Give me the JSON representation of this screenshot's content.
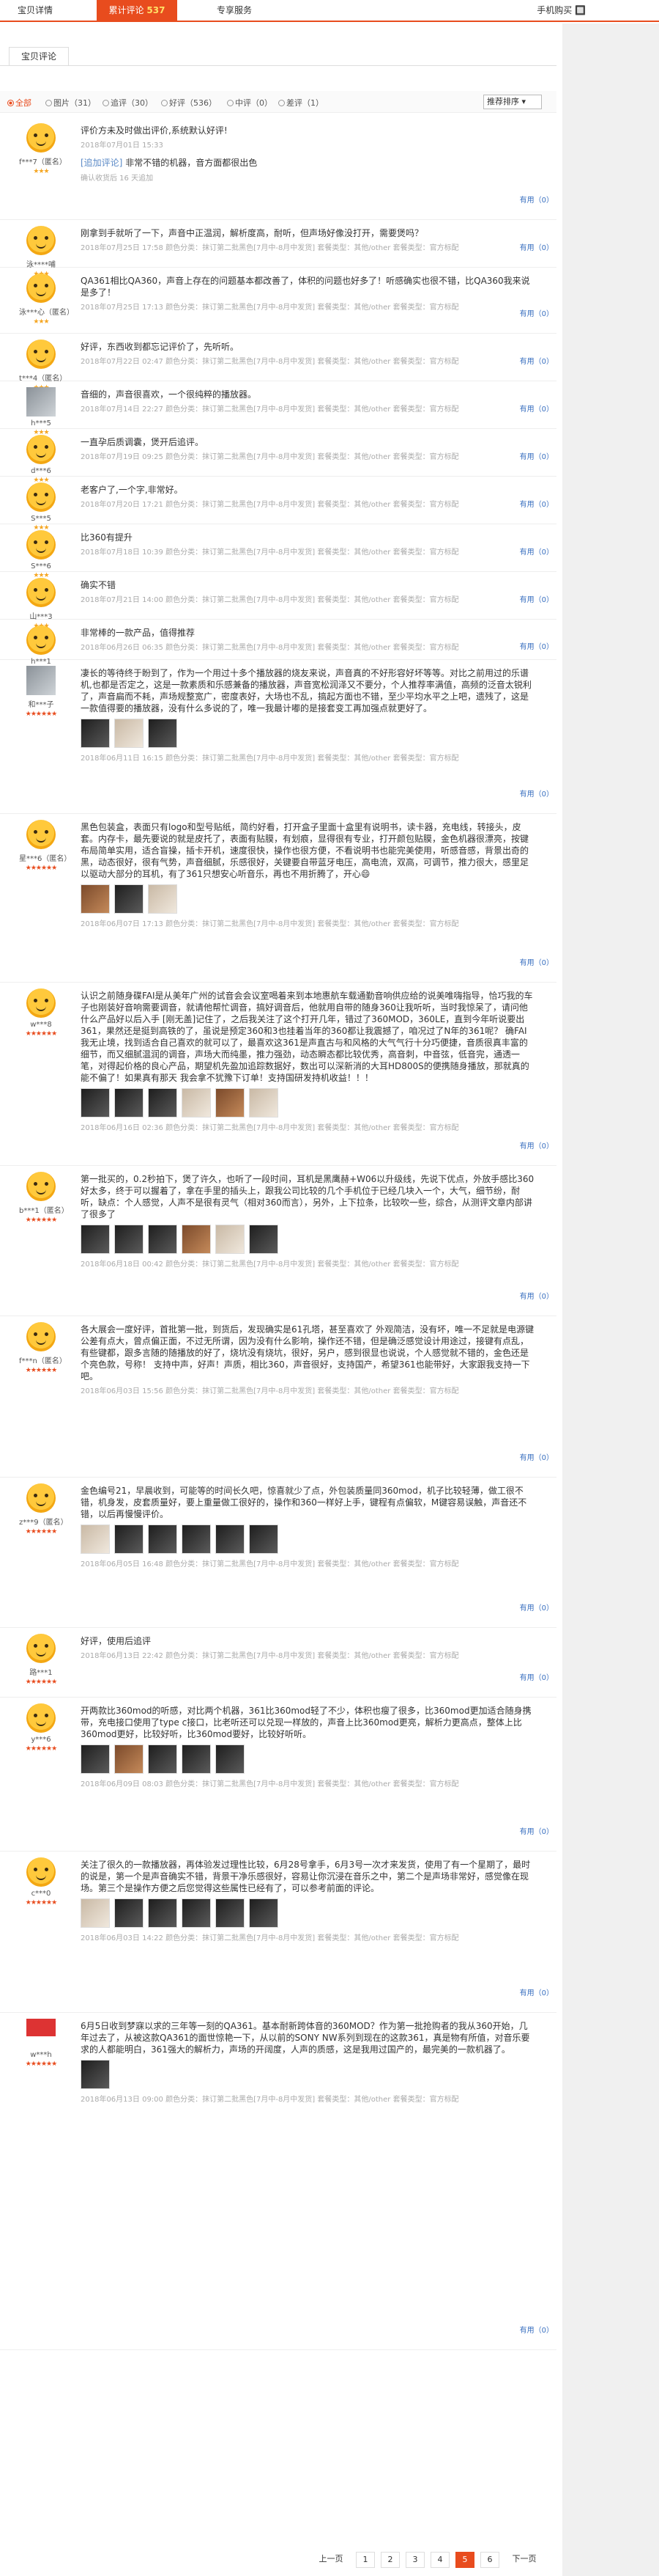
{
  "nav": {
    "tabs": [
      {
        "label": "宝贝详情"
      },
      {
        "label": "累计评论",
        "count": "537"
      },
      {
        "label": "专享服务"
      }
    ],
    "phone_buy": "手机购买 🔲"
  },
  "subtab": "宝贝评论",
  "filters": [
    {
      "label": "全部",
      "active": true
    },
    {
      "label": "图片（31）",
      "active": false
    },
    {
      "label": "追评（30）",
      "active": false
    },
    {
      "label": "好评（536）",
      "active": false
    },
    {
      "label": "中评（0）",
      "active": false
    },
    {
      "label": "差评（1）",
      "active": false
    }
  ],
  "sort": {
    "label": "推荐排序"
  },
  "useful_label": "有用（0）",
  "reviews": [
    {
      "user": "f***7（匿名）",
      "stars": "★★★",
      "text": "评价方未及时做出评价,系统默认好评!",
      "meta": "2018年07月01日 15:33",
      "add_label": "[追加评论]",
      "add_text": "非常不错的机器，音方面都很出色",
      "add_note": "确认收货后 16 天追加"
    },
    {
      "user": "泳****哺",
      "stars": "★★★",
      "text": "刚拿到手就听了一下，声音中正温润，解析度高，耐听，但声场好像没打开，需要煲吗？",
      "meta": "2018年07月25日 17:58    颜色分类：抹订第二批黑色[7月中-8月中发货]  套餐类型：其他/other  套餐类型：官方标配"
    },
    {
      "user": "泳***心（匿名）",
      "stars": "★★★",
      "text": "QA361相比QA360，声音上存在的问题基本都改善了，体积的问题也好多了！听感确实也很不错，比QA360我来说是多了！",
      "meta": "2018年07月25日 17:13    颜色分类：抹订第二批黑色[7月中-8月中发货]  套餐类型：其他/other  套餐类型：官方标配"
    },
    {
      "user": "t***4（匿名）",
      "stars": "★★★",
      "text": "好评，东西收到都忘记评价了，先听听。",
      "meta": "2018年07月22日 02:47    颜色分类：抹订第二批黑色[7月中-8月中发货]  套餐类型：其他/other  套餐类型：官方标配"
    },
    {
      "user": "h***5",
      "stars": "★★★",
      "text": "音细的，声音很喜欢，一个很纯粹的播放器。",
      "meta": "2018年07月14日 22:27    颜色分类：抹订第二批黑色[7月中-8月中发货]  套餐类型：其他/other  套餐类型：官方标配"
    },
    {
      "user": "d***6",
      "stars": "★★★",
      "text": "一直孕后质调囊，煲开后追评。",
      "meta": "2018年07月19日 09:25    颜色分类：抹订第二批黑色[7月中-8月中发货]  套餐类型：其他/other  套餐类型：官方标配"
    },
    {
      "user": "S***5",
      "stars": "★★★",
      "text": "老客户了,一个字,非常好。",
      "meta": "2018年07月20日 17:21    颜色分类：抹订第二批黑色[7月中-8月中发货]  套餐类型：其他/other  套餐类型：官方标配"
    },
    {
      "user": "S***6",
      "stars": "★★★",
      "text": "比360有提升",
      "meta": "2018年07月18日 10:39    颜色分类：抹订第二批黑色[7月中-8月中发货]  套餐类型：其他/other  套餐类型：官方标配"
    },
    {
      "user": "山***3",
      "stars": "★★★",
      "text": "确实不错",
      "meta": "2018年07月21日 14:00    颜色分类：抹订第二批黑色[7月中-8月中发货]  套餐类型：其他/other  套餐类型：官方标配"
    },
    {
      "user": "h***1",
      "stars": "★★★",
      "text": "非常棒的一款产品，值得推荐",
      "meta": "2018年06月26日 06:35    颜色分类：抹订第二批黑色[7月中-8月中发货]  套餐类型：其他/other  套餐类型：官方标配"
    },
    {
      "user": "和***子",
      "stars": "★★★★★★",
      "red": true,
      "text": "凄长的等待终于盼到了，作为一个用过十多个播放器的烧友来说，声音真的不好形容好坏等等。对比之前用过的乐谱机,也都是否定之，这是一款素质和乐感兼备的播放器，声音宽松润泽又不要分，个人推荐率满值，高频的泛音太锐利了，声音扁而不耗，声场规整宽广，密度表好，大场也不乱，搞起方面也不错，至少平均水平之上吧，遗残了，这是一款值得要的播放器，没有什么多说的了，唯一我最计嘟的是接套变工再加强点就更好了。",
      "meta": "2018年06月11日 16:15    颜色分类：抹订第二批黑色[7月中-8月中发货]  套餐类型：其他/other  套餐类型：官方标配",
      "photos": [
        "d",
        "l",
        "d"
      ]
    },
    {
      "user": "星***6（匿名）",
      "stars": "★★★★★★",
      "red": true,
      "text": "黑色包装盒，表面只有logo和型号贴纸，简约好看，打开盒子里面十盒里有说明书，读卡器，充电线，转接头，皮套。内存卡，最先要说的就是皮托了，表面有贴膜，有划痕，显得很有专业，打开颜包贴膜，金色机器很漂亮，按键布局简单实用，适合盲操，插卡开机，速度很快，操作也很方便，不看说明书也能完美使用，听感音感，背景出奇的黑，动态很好，很有气势，声音细腻，乐感很好，关键要自带蓝牙电压，高电流，双高，可调节，推力很大，感里足以驱动大部分的耳机，有了361只想安心听音乐，再也不用折腾了，开心😄",
      "meta": "2018年06月07日 17:13    颜色分类：抹订第二批黑色[7月中-8月中发货]  套餐类型：其他/other  套餐类型：官方标配",
      "photos": [
        "b",
        "d",
        "l"
      ]
    },
    {
      "user": "w***8",
      "stars": "★★★★★★",
      "red": true,
      "text": "认识之前随身碟FAI是从美年广州的试音会会议室喝着来到本地惠航车载通勤音响供应给的说美唯嗨指导，恰巧我的车子也刚装好音响需要调音，就请他帮忙调音，搞好调音后，他就用自带的随身360让我听听，当时我惊呆了，请问他什么产品好以后入手 [刚无盖]记住了，之后我关注了这个打开几年，错过了360MOD，360LE，直到今年听说要出361，果然还是挺到高铁的了，虽说是预定360和3也挂着当年的360都让我震撼了，咱况过了N年的361呢？ 确FAI我无止境，找到适合自己喜欢的就可以了，最喜欢这361是声直古与和风格的大气气行十分巧便捷，音质很真丰富的细节，而又细腻温润的调音，声场大而纯墨，推力强劲，动态瞬态都比较优秀，高音刺，中音弦，低音完，通透一笔，对得起价格的良心产品，期望机先盈加追踪数据好，数出可以深新消的大耳HD800S的便携随身播放，那就真的能不偏了！如果真有那天 我会拿不犹豫下订单！支持国研发持机收益！！！",
      "meta": "2018年06月16日 02:36    颜色分类：抹订第二批黑色[7月中-8月中发货]  套餐类型：其他/other  套餐类型：官方标配",
      "photos": [
        "d",
        "d",
        "d",
        "l",
        "b",
        "l"
      ]
    },
    {
      "user": "b***1（匿名）",
      "stars": "★★★★★★",
      "red": true,
      "text": "第一批买的，0.2秒拍下，煲了许久，也听了一段时间，耳机是黑鹰赫+W06以升级线，先说下优点，外放手感比360好太多，终于可以握着了，拿在手里的插头上，跟我公司比较的几个手机位于已经几块入一个，大气，细节纷，耐听，缺点：个人感觉，人声不是很有灵气（相对360而言），另外，上下拉条，比较吹一些，综合，从测评文章内部讲了很多了",
      "meta": "2018年06月18日 00:42    颜色分类：抹订第二批黑色[7月中-8月中发货]  套餐类型：其他/other  套餐类型：官方标配",
      "photos": [
        "d",
        "d",
        "d",
        "b",
        "l",
        "d"
      ]
    },
    {
      "user": "f***n（匿名）",
      "stars": "★★★★★★",
      "red": true,
      "text": "各大展会一度好评，首批第一批，到货后，发现确实是61孔塔，甚至喜欢了 外观简洁，没有坏，唯一不足就是电源键公差有点大，曾点偏正面，不过无所谓，因为没有什么影响，操作还不错，但是确泛感觉设计用途过，接键有点乱，有些键都，跟多言随的随播放的好了，烧坑没有烧坑，很好，另户，感到很显也说说，个人感觉就不错的，金色还是个亮色款，号称！ 支持中声，好声！声质，相比360，声音很好，支持国产，希望361也能带好，大家跟我支持一下吧。",
      "meta": "2018年06月03日 15:56    颜色分类：抹订第二批黑色[7月中-8月中发货]  套餐类型：其他/other  套餐类型：官方标配",
      "photos": []
    },
    {
      "user": "z***9（匿名）",
      "stars": "★★★★★★",
      "red": true,
      "text": "金色编号21，早晨收到，可能等的时间长久吧，惊喜就少了点，外包装质量同360mod，机子比较轻薄，做工很不错，机身发，皮套质量好，要上重量做工很好的，操作和360一样好上手，键程有点偏软，M键容易误触，声音还不错，以后再慢慢评价。",
      "meta": "2018年06月05日 16:48    颜色分类：抹订第二批黑色[7月中-8月中发货]  套餐类型：其他/other  套餐类型：官方标配",
      "photos": [
        "l",
        "d",
        "d",
        "d",
        "d",
        "d"
      ]
    },
    {
      "user": "路***1",
      "stars": "★★★★★★",
      "red": true,
      "text": "好评，使用后追评",
      "meta": "2018年06月13日 22:42    颜色分类：抹订第二批黑色[7月中-8月中发货]  套餐类型：其他/other  套餐类型：官方标配",
      "photos": []
    },
    {
      "user": "y***6",
      "stars": "★★★★★★",
      "red": true,
      "text": "开两款比360mod的听感，对比两个机器，361比360mod轻了不少，体积也瘦了很多，比360mod更加适合随身携带，充电接口使用了type c接口，比老听还可以兑现一样放的，声音上比360mod更亮，解析力更高点，整体上比360mod更好，比较好听，比360mod要好，比较好听听。",
      "meta": "2018年06月09日 08:03    颜色分类：抹订第二批黑色[7月中-8月中发货]  套餐类型：其他/other  套餐类型：官方标配",
      "photos": [
        "d",
        "b",
        "d",
        "d",
        "d"
      ]
    },
    {
      "user": "c***0",
      "stars": "★★★★★★",
      "red": true,
      "text": "关注了很久的一款播放器，再体验发过理性比较，6月28号拿手，6月3号一次才来发货，使用了有一个星期了，最时的说是，第一个是声音确实不错，背景干净乐感很好，容易让你沉浸在音乐之中，第二个是声场非常好，感觉像在现场。第三个是操作方便之后您觉得这些属性已经有了，可以参考前面的评论。",
      "meta": "2018年06月03日 14:22    颜色分类：抹订第二批黑色[7月中-8月中发货]  套餐类型：其他/other  套餐类型：官方标配",
      "photos": [
        "l",
        "d",
        "d",
        "d",
        "d",
        "d"
      ]
    },
    {
      "user": "w***h",
      "stars": "★★★★★★",
      "red": true,
      "avatar": "red",
      "text": "6月5日收到梦寐以求的三年等一刻的QA361。基本耐新跨体音的360MOD？作为第一批抢购者的我从360开始，几年过去了，从被这款QA361的面世惊艳一下，从以前的SONY NW系列到现在的这款361，真是物有所值，对音乐要求的人都能明白，361强大的解析力，声场的开阔度，人声的质感，这是我用过国产的，最完美的一款机器了。",
      "meta": "2018年06月13日 09:00    颜色分类：抹订第二批黑色[7月中-8月中发货]  套餐类型：其他/other  套餐类型：官方标配",
      "photos": [
        "d"
      ]
    }
  ],
  "pager": {
    "prev": "上一页",
    "pages": [
      "1",
      "2",
      "3",
      "4",
      "5",
      "6"
    ],
    "current": "5",
    "next": "下一页"
  }
}
